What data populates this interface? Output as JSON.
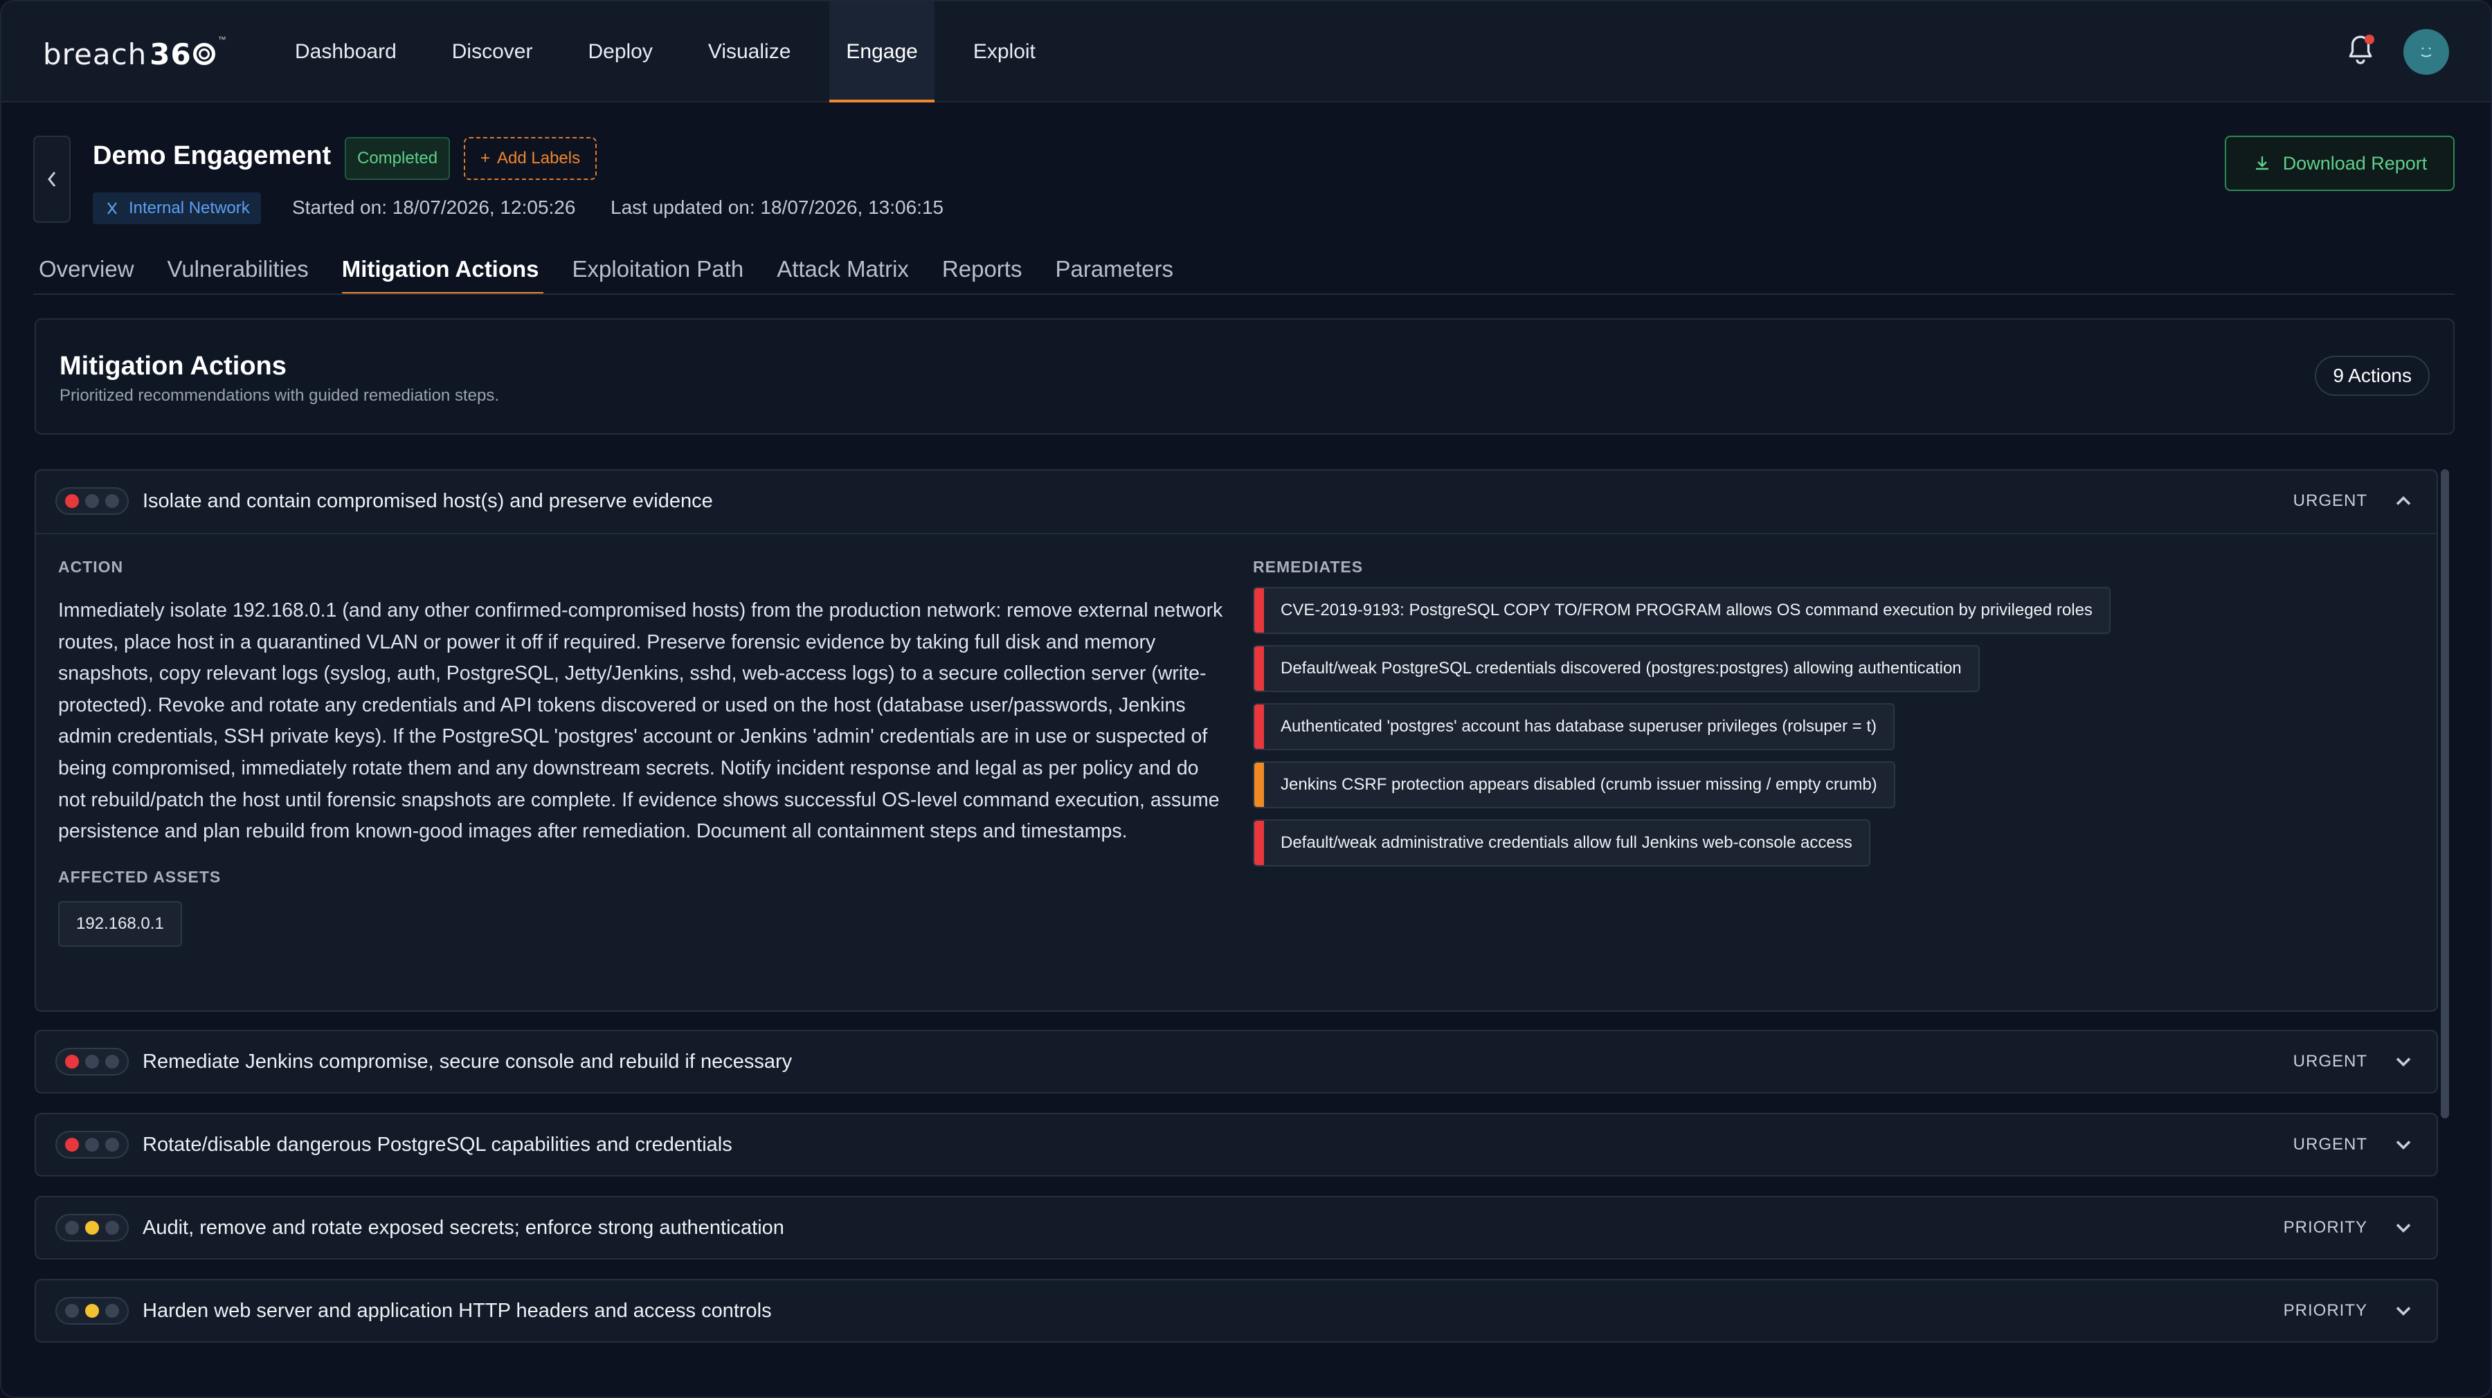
{
  "app": {
    "logo_word": "breach",
    "logo_num": "36",
    "logo_tm": "™"
  },
  "nav": [
    {
      "label": "Dashboard",
      "active": false
    },
    {
      "label": "Discover",
      "active": false
    },
    {
      "label": "Deploy",
      "active": false
    },
    {
      "label": "Visualize",
      "active": false
    },
    {
      "label": "Engage",
      "active": true
    },
    {
      "label": "Exploit",
      "active": false
    }
  ],
  "engagement": {
    "title": "Demo Engagement",
    "status": "Completed",
    "add_labels": "Add Labels",
    "network": "Internal Network",
    "started": "Started on: 18/07/2026, 12:05:26",
    "updated": "Last updated on: 18/07/2026, 13:06:15",
    "download": "Download Report"
  },
  "tabs": [
    {
      "label": "Overview",
      "active": false
    },
    {
      "label": "Vulnerabilities",
      "active": false
    },
    {
      "label": "Mitigation Actions",
      "active": true
    },
    {
      "label": "Exploitation Path",
      "active": false
    },
    {
      "label": "Attack Matrix",
      "active": false
    },
    {
      "label": "Reports",
      "active": false
    },
    {
      "label": "Parameters",
      "active": false
    }
  ],
  "section": {
    "title": "Mitigation Actions",
    "subtitle": "Prioritized recommendations with guided remediation steps.",
    "count": "9 Actions"
  },
  "labels": {
    "action": "ACTION",
    "remediates": "REMEDIATES",
    "affected_assets": "AFFECTED ASSETS"
  },
  "colors": {
    "accent": "#f0862f",
    "urgent": "#e8383d",
    "priority": "#f2c230",
    "high": "#f08a24",
    "success": "#5fd08b"
  },
  "actions": [
    {
      "title": "Isolate and contain compromised host(s) and preserve evidence",
      "level": "URGENT",
      "expanded": true,
      "description": "Immediately isolate 192.168.0.1 (and any other confirmed-compromised hosts) from the production network: remove external network routes, place host in a quarantined VLAN or power it off if required. Preserve forensic evidence by taking full disk and memory snapshots, copy relevant logs (syslog, auth, PostgreSQL, Jetty/Jenkins, sshd, web-access logs) to a secure collection server (write-protected). Revoke and rotate any credentials and API tokens discovered or used on the host (database user/passwords, Jenkins admin credentials, SSH private keys). If the PostgreSQL 'postgres' account or Jenkins 'admin' credentials are in use or suspected of being compromised, immediately rotate them and any downstream secrets. Notify incident response and legal as per policy and do not rebuild/patch the host until forensic snapshots are complete. If evidence shows successful OS-level command execution, assume persistence and plan rebuild from known-good images after remediation. Document all containment steps and timestamps.",
      "asset": "192.168.0.1",
      "remediates": [
        {
          "text": "CVE-2019-9193: PostgreSQL COPY TO/FROM PROGRAM allows OS command execution by privileged roles",
          "severity": "critical"
        },
        {
          "text": "Default/weak PostgreSQL credentials discovered (postgres:postgres) allowing authentication",
          "severity": "critical"
        },
        {
          "text": "Authenticated 'postgres' account has database superuser privileges (rolsuper = t)",
          "severity": "critical"
        },
        {
          "text": "Jenkins CSRF protection appears disabled (crumb issuer missing / empty crumb)",
          "severity": "high"
        },
        {
          "text": "Default/weak administrative credentials allow full Jenkins web-console access",
          "severity": "critical"
        }
      ]
    },
    {
      "title": "Remediate Jenkins compromise, secure console and rebuild if necessary",
      "level": "URGENT",
      "expanded": false
    },
    {
      "title": "Rotate/disable dangerous PostgreSQL capabilities and credentials",
      "level": "URGENT",
      "expanded": false
    },
    {
      "title": "Audit, remove and rotate exposed secrets; enforce strong authentication",
      "level": "PRIORITY",
      "expanded": false
    },
    {
      "title": "Harden web server and application HTTP headers and access controls",
      "level": "PRIORITY",
      "expanded": false
    }
  ]
}
